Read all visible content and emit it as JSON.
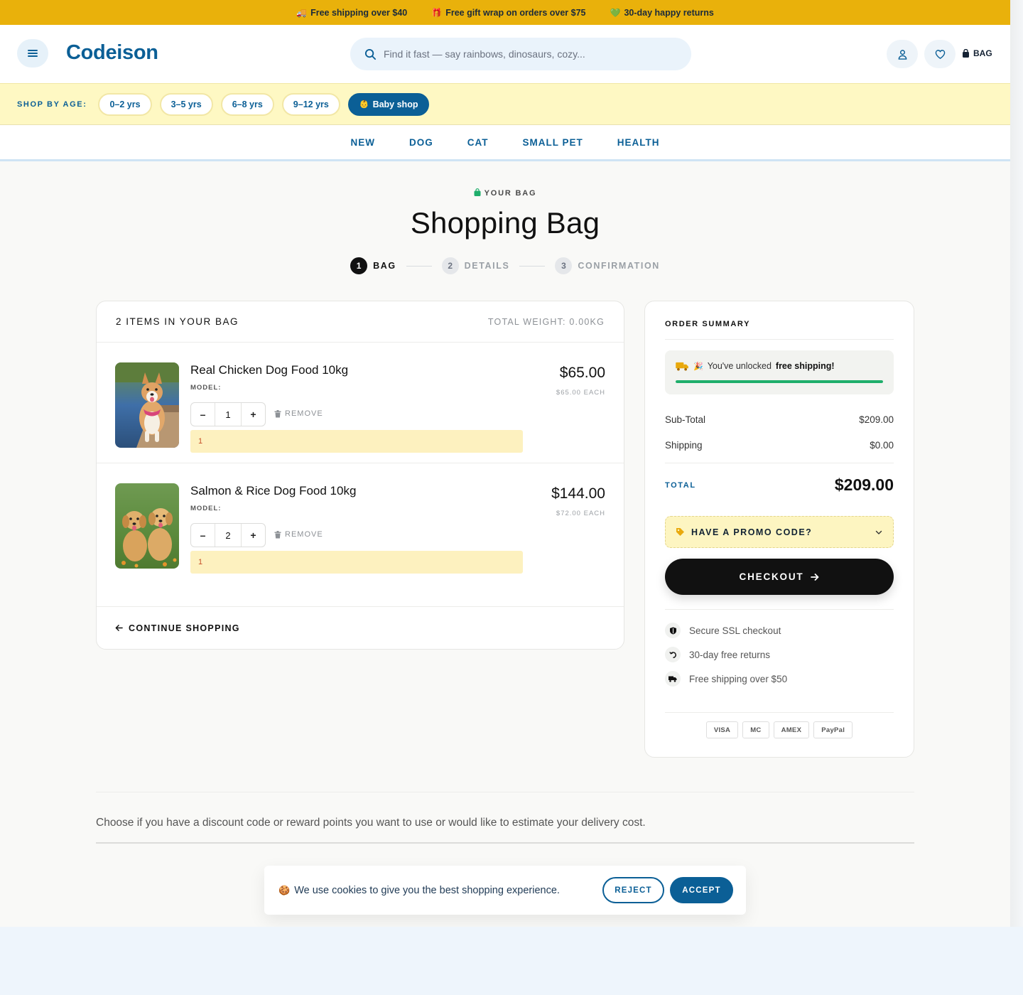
{
  "promo_bar": {
    "items": [
      {
        "icon": "truck-icon",
        "text": "Free shipping over $40"
      },
      {
        "icon": "gift-icon",
        "text": "Free gift wrap on orders over $75"
      },
      {
        "icon": "heart-icon",
        "text": "30-day happy returns"
      }
    ]
  },
  "header": {
    "logo": "Codeison",
    "search_placeholder": "Find it fast — say rainbows, dinosaurs, cozy...",
    "bag_label": "BAG"
  },
  "age_bar": {
    "label": "SHOP BY AGE:",
    "pills": [
      "0–2 yrs",
      "3–5 yrs",
      "6–8 yrs",
      "9–12 yrs"
    ],
    "baby_shop": "Baby shop"
  },
  "nav": [
    "NEW",
    "DOG",
    "CAT",
    "SMALL PET",
    "HEALTH"
  ],
  "page": {
    "eyebrow": "YOUR BAG",
    "title": "Shopping Bag",
    "steps": [
      {
        "num": "1",
        "label": "BAG",
        "active": true
      },
      {
        "num": "2",
        "label": "DETAILS",
        "active": false
      },
      {
        "num": "3",
        "label": "CONFIRMATION",
        "active": false
      }
    ]
  },
  "bag": {
    "count_label": "2 ITEMS IN YOUR BAG",
    "weight_label": "TOTAL WEIGHT: 0.00KG",
    "items": [
      {
        "name": "Real Chicken Dog Food 10kg",
        "model": "MODEL:",
        "qty": "1",
        "remove": "REMOVE",
        "note": "1",
        "price": "$65.00",
        "each": "$65.00 EACH"
      },
      {
        "name": "Salmon & Rice Dog Food 10kg",
        "model": "MODEL:",
        "qty": "2",
        "remove": "REMOVE",
        "note": "1",
        "price": "$144.00",
        "each": "$72.00 EACH"
      }
    ],
    "continue": "CONTINUE SHOPPING"
  },
  "summary": {
    "title": "ORDER SUMMARY",
    "shipping_msg_prefix": "You've unlocked",
    "shipping_msg_bold": "free shipping!",
    "shipping_progress": 1.0,
    "subtotal_label": "Sub-Total",
    "subtotal": "$209.00",
    "shipping_label": "Shipping",
    "shipping": "$0.00",
    "total_label": "TOTAL",
    "total": "$209.00",
    "promo_label": "HAVE A PROMO CODE?",
    "checkout": "CHECKOUT",
    "trust": [
      "Secure SSL checkout",
      "30-day free returns",
      "Free shipping over $50"
    ],
    "payments": [
      "VISA",
      "MC",
      "AMEX",
      "PayPal"
    ]
  },
  "info_text": "Choose if you have a discount code or reward points you want to use or would like to estimate your delivery cost.",
  "cookie": {
    "text": "We use cookies to give you the best shopping experience.",
    "reject": "REJECT",
    "accept": "ACCEPT"
  },
  "colors": {
    "brand": "#0b5f96",
    "promo_bar": "#e9b10b",
    "age_bar": "#fef8c3",
    "success": "#1fae6b"
  }
}
